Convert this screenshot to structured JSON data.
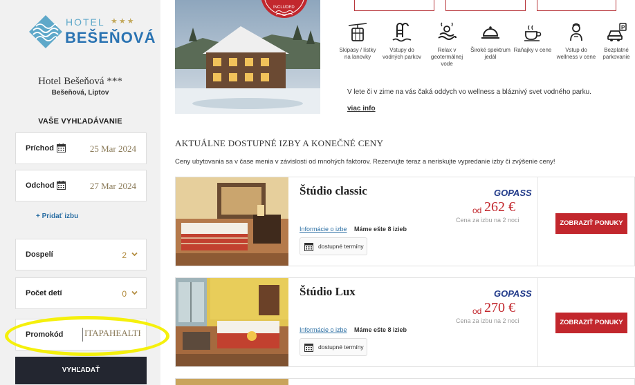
{
  "hotel": {
    "logo_hotel": "HOTEL",
    "logo_stars": "★★★",
    "logo_name": "BEŠEŇOVÁ",
    "name": "Hotel Bešeňová ***",
    "location": "Bešeňová, Liptov"
  },
  "search": {
    "title": "VAŠE VYHĽADÁVANIE",
    "arrival_label": "Príchod",
    "arrival_date": "25 Mar 2024",
    "departure_label": "Odchod",
    "departure_date": "27 Mar 2024",
    "add_room": "+ Pridať izbu",
    "adults_label": "Dospelí",
    "adults_value": "2",
    "children_label": "Počet detí",
    "children_value": "0",
    "promo_label": "Promokód",
    "promo_value": "ITAPAHEALTH",
    "submit": "VYHĽADAŤ"
  },
  "hero": {
    "badge_text": "INCLUDED"
  },
  "amenities": [
    {
      "icon": "ski-lift-icon",
      "label": "Skipasy / lístky na lanovky"
    },
    {
      "icon": "pool-ladder-icon",
      "label": "Vstupy do vodných parkov"
    },
    {
      "icon": "thermal-water-icon",
      "label": "Relax v geotermálnej vode"
    },
    {
      "icon": "food-tray-icon",
      "label": "Široké spektrum jedál"
    },
    {
      "icon": "breakfast-icon",
      "label": "Raňajky v cene"
    },
    {
      "icon": "wellness-icon",
      "label": "Vstup do wellness v cene"
    },
    {
      "icon": "parking-icon",
      "label": "Bezplatné parkovanie"
    }
  ],
  "intro": {
    "text": "V lete či v zime na vás čaká oddych vo wellness a bláznivý svet vodného parku.",
    "more_link": "viac info"
  },
  "rooms_section": {
    "title": "AKTUÁLNE DOSTUPNÉ IZBY A KONEČNÉ CENY",
    "description": "Ceny ubytovania sa v čase menia v závislosti od mnohých faktorov. Rezervujte teraz a neriskujte vypredanie izby či zvýšenie ceny!"
  },
  "rooms": [
    {
      "name": "Štúdio classic",
      "brand": "GOPASS",
      "price_prefix": "od",
      "price": "262 €",
      "price_note": "Cena za izbu na 2 noci",
      "info_link": "Informácie o izbe",
      "rooms_left": "Máme ešte 8 izieb",
      "availability": "dostupné termíny",
      "offer_button": "ZOBRAZIŤ PONUKY"
    },
    {
      "name": "Štúdio Lux",
      "brand": "GOPASS",
      "price_prefix": "od",
      "price": "270 €",
      "price_note": "Cena za izbu na 2 noci",
      "info_link": "Informácie o izbe",
      "rooms_left": "Máme ešte 8 izieb",
      "availability": "dostupné termíny",
      "offer_button": "ZOBRAZIŤ PONUKY"
    }
  ],
  "colors": {
    "accent_red": "#c2272d",
    "dark_button": "#232630",
    "brand_blue": "#2a73b2",
    "highlight_yellow": "#f5f00c"
  }
}
